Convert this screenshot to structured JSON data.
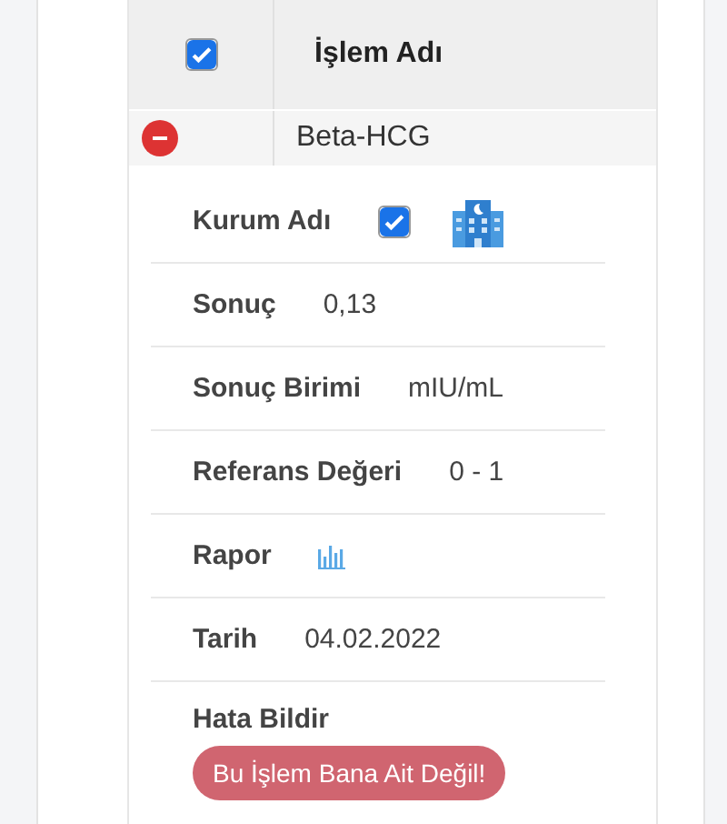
{
  "table": {
    "header_checked": true,
    "columns": [
      "İşlem Adı"
    ],
    "rows": [
      {
        "expanded": true,
        "name": "Beta-HCG"
      }
    ]
  },
  "details": [
    {
      "kind": "institution",
      "label": "Kurum Adı",
      "checked": true
    },
    {
      "kind": "text",
      "label": "Sonuç",
      "value": "0,13"
    },
    {
      "kind": "text",
      "label": "Sonuç Birimi",
      "value": "mIU/mL"
    },
    {
      "kind": "text",
      "label": "Referans Değeri",
      "value": "0 - 1"
    },
    {
      "kind": "report",
      "label": "Rapor"
    },
    {
      "kind": "text",
      "label": "Tarih",
      "value": "04.02.2022"
    },
    {
      "kind": "action",
      "label": "Hata Bildir",
      "button": "Bu İşlem Bana Ait Değil!"
    }
  ]
}
